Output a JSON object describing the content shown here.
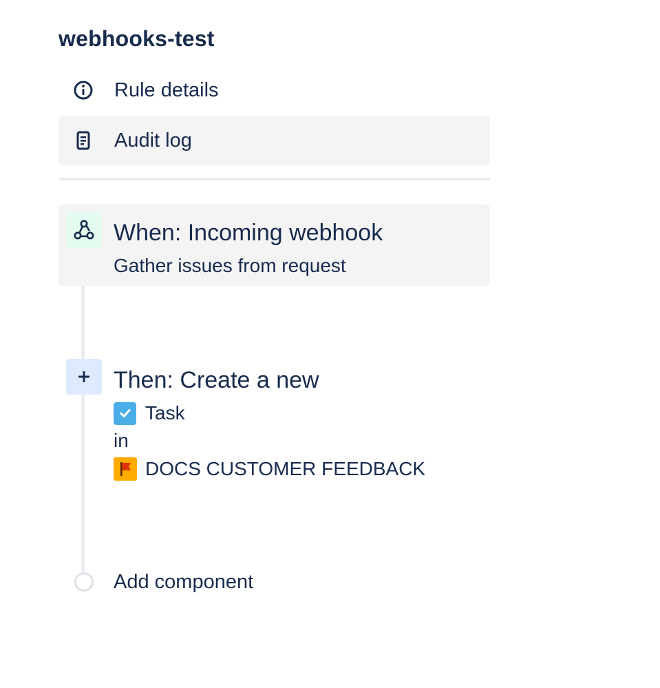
{
  "rule": {
    "name": "webhooks-test"
  },
  "nav": {
    "rule_details": {
      "label": "Rule details",
      "icon": "info-icon"
    },
    "audit_log": {
      "label": "Audit log",
      "icon": "document-icon"
    }
  },
  "trigger": {
    "icon": "webhook-icon",
    "title": "When: Incoming webhook",
    "subtitle": "Gather issues from request"
  },
  "action": {
    "icon": "plus-icon",
    "title": "Then: Create a new",
    "issue_type": "Task",
    "issue_type_icon": "task-checkbox-icon",
    "connector": "in",
    "project": "DOCS CUSTOMER FEEDBACK",
    "project_icon": "flag-icon"
  },
  "add_component": {
    "label": "Add component"
  },
  "colors": {
    "text": "#172b4d",
    "selected_bg": "#f4f4f5",
    "trigger_icon_bg": "#e3fcef",
    "action_icon_bg": "#deebff",
    "task_blue": "#4bade8",
    "project_orange": "#ffab00",
    "flag_red": "#de350b",
    "timeline": "#ebecf0"
  }
}
